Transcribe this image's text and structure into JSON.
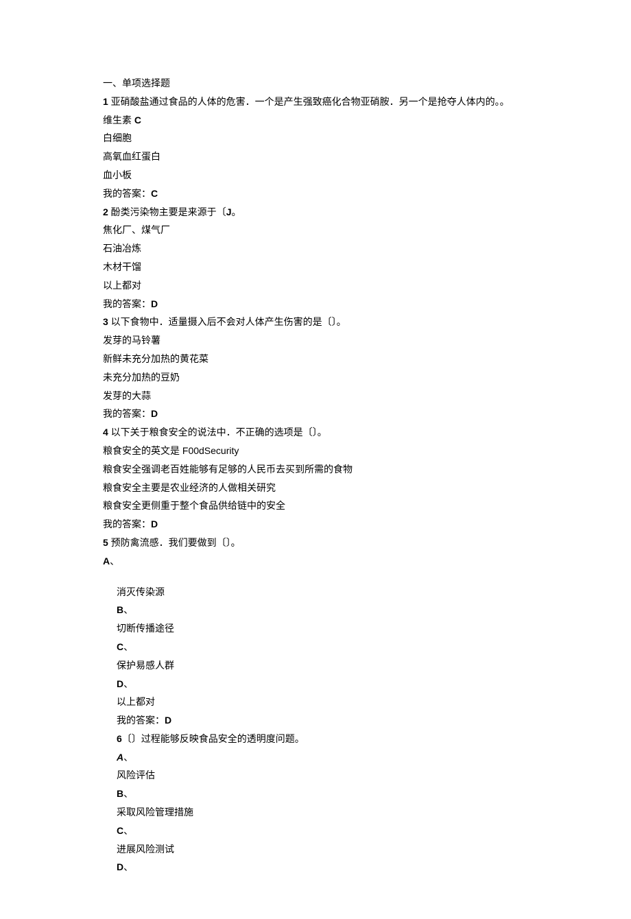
{
  "header": "一、单项选择题",
  "q1": {
    "num": "1",
    "text": " 亚硝酸盐通过食品的人体的危害．一个是产生强致癌化合物亚硝胺．另一个是抢夺人体内的。。",
    "optA_pre": "维生素 ",
    "optA_bold": "C",
    "optB": "白细胞",
    "optC": "高氧血红蛋白",
    "optD": "血小板",
    "ans_label": "我的答案：",
    "ans": "C"
  },
  "q2": {
    "num": "2",
    "text": " 酚类污染物主要是来源于〔",
    "tail_bold": "J",
    "tail": "。",
    "optA": "焦化厂、煤气厂",
    "optB": "石油冶炼",
    "optC": "木材干馏",
    "optD": "以上都对",
    "ans_label": "我的答案：",
    "ans": "D"
  },
  "q3": {
    "num": "3",
    "text": " 以下食物中．适量摄入后不会对人体产生伤害的是〔〕。",
    "optA": "发芽的马铃薯",
    "optB": "新鲜未充分加热的黄花菜",
    "optC": "未充分加热的豆奶",
    "optD": "发芽的大蒜",
    "ans_label": "我的答案：",
    "ans": "D"
  },
  "q4": {
    "num": "4",
    "text": " 以下关于粮食安全的说法中．不正确的选项是〔〕。",
    "optA": "粮食安全的英文是 F00dSecurity",
    "optB": "粮食安全强调老百姓能够有足够的人民币去买到所需的食物",
    "optC": "粮食安全主要是农业经济的人做相关研究",
    "optD": "粮食安全更侧重于整个食品供给链中的安全",
    "ans_label": "我的答案：",
    "ans": "D"
  },
  "q5": {
    "num": "5",
    "text": " 预防禽流感．我们要做到〔〕。",
    "lblA": "A",
    "punc": "、",
    "optA": "消灭传染源",
    "lblB": "B",
    "optB": "切断传播途径",
    "lblC": "C",
    "optC": "保护易感人群",
    "lblD": "D",
    "optD": "以上都对",
    "ans_label": "我的答案：",
    "ans": "D"
  },
  "q6": {
    "num": "6",
    "text": "〔〕过程能够反映食品安全的透明度问题。",
    "lblA": "A",
    "punc": "、",
    "optA": "风险评估",
    "lblB": "B",
    "optB": "采取风险管理措施",
    "lblC": "C",
    "optC": "进展风险测试",
    "lblD": "D"
  }
}
